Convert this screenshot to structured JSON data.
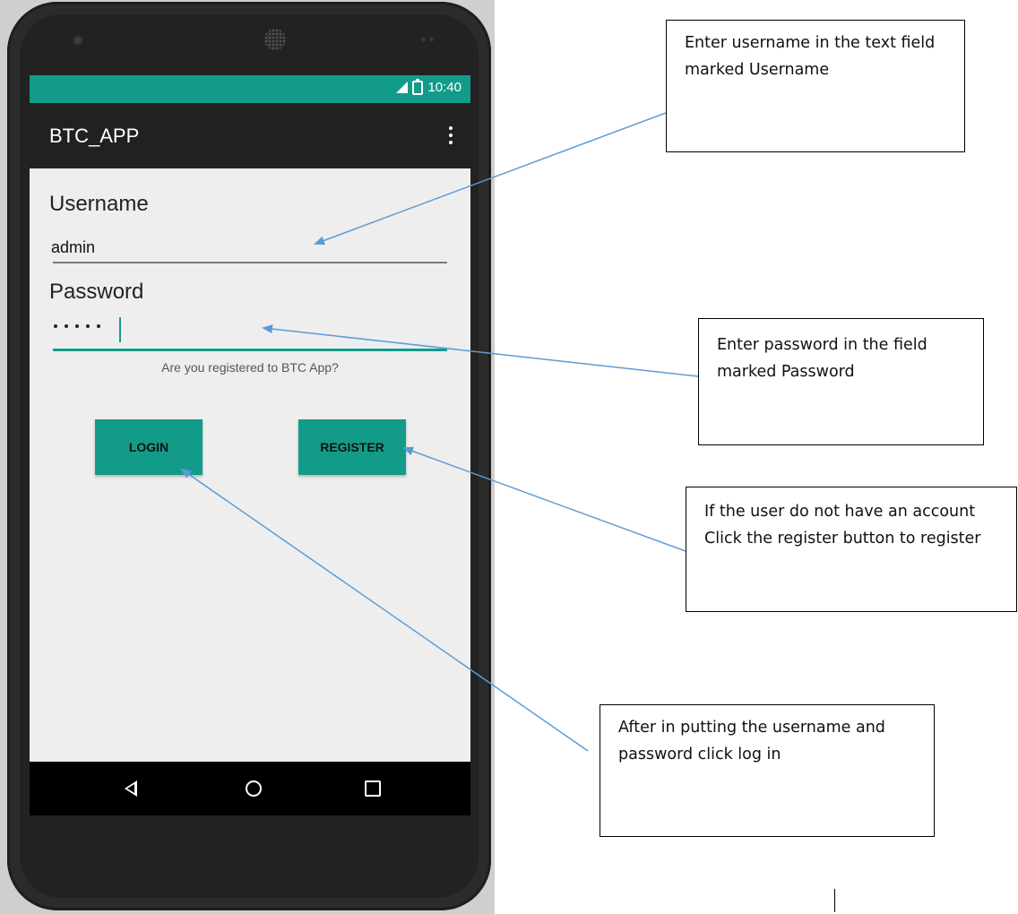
{
  "status_bar": {
    "time": "10:40",
    "color": "#139b8a"
  },
  "app_bar": {
    "title": "BTC_APP",
    "overflow_icon": "more-vert-icon"
  },
  "form": {
    "username_label": "Username",
    "username_value": "admin",
    "password_label": "Password",
    "password_value": "•••••",
    "question": "Are you registered to BTC App?",
    "login_label": "LOGIN",
    "register_label": "REGISTER",
    "accent": "#139b8a"
  },
  "nav_bar": {
    "back": "back-icon",
    "home": "home-icon",
    "recents": "recents-icon"
  },
  "callouts": {
    "username": "Enter username in the text field marked Username",
    "password": "Enter password in the field marked Password",
    "register": "If the user do not have an account Click the register button to register",
    "login": "After in putting the username and password click log in"
  }
}
